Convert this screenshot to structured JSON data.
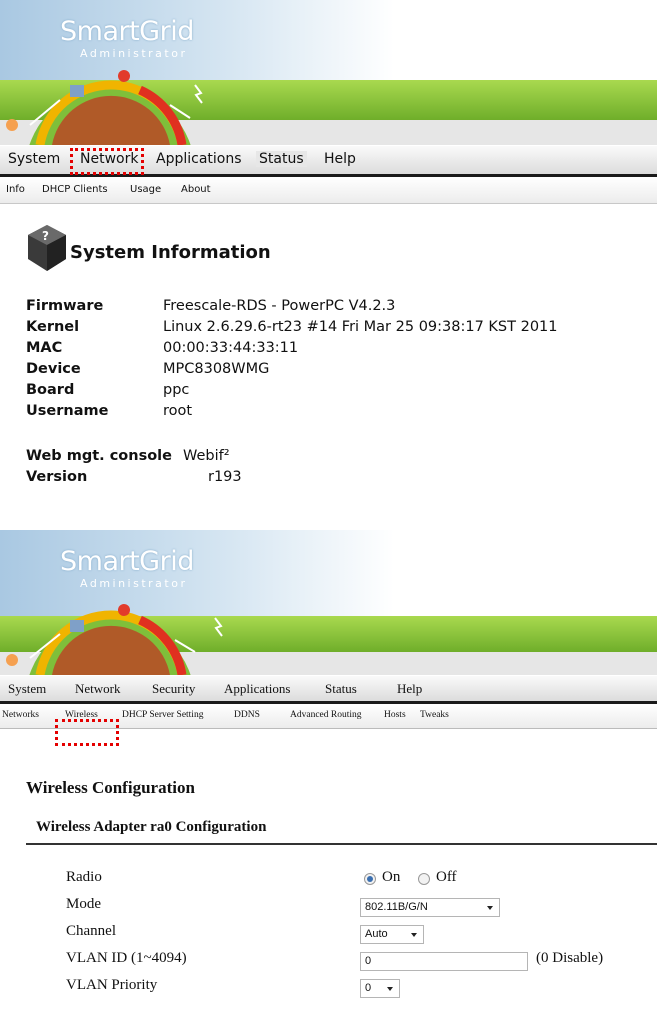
{
  "panel1": {
    "logo": {
      "title": "SmartGrid",
      "subtitle": "Administrator"
    },
    "menu": [
      "System",
      "Network",
      "Applications",
      "Status",
      "Help"
    ],
    "submenu": [
      "Info",
      "DHCP Clients",
      "Usage",
      "About"
    ],
    "page_title": "System Information",
    "info_rows": [
      {
        "label": "Firmware",
        "value": "Freescale-RDS - PowerPC V4.2.3"
      },
      {
        "label": "Kernel",
        "value": "Linux 2.6.29.6-rt23 #14 Fri Mar 25 09:38:17 KST 2011"
      },
      {
        "label": "MAC",
        "value": "00:00:33:44:33:11"
      },
      {
        "label": "Device",
        "value": "MPC8308WMG"
      },
      {
        "label": "Board",
        "value": "ppc"
      },
      {
        "label": "Username",
        "value": "root"
      }
    ],
    "web_console": {
      "label": "Web mgt. console",
      "value": "Webif²"
    },
    "version": {
      "label": "Version",
      "value": "r193"
    }
  },
  "panel2": {
    "logo": {
      "title": "SmartGrid",
      "subtitle": "Administrator"
    },
    "menu": [
      "System",
      "Network",
      "Security",
      "Applications",
      "Status",
      "Help"
    ],
    "submenu": [
      "Networks",
      "Wireless",
      "DHCP Server Setting",
      "DDNS",
      "Advanced Routing",
      "Hosts",
      "Tweaks"
    ],
    "page_title": "Wireless Configuration",
    "adapter_heading": "Wireless Adapter ra0 Configuration",
    "fields": {
      "radio": {
        "label": "Radio",
        "options": [
          "On",
          "Off"
        ],
        "selected": "On"
      },
      "mode": {
        "label": "Mode",
        "value": "802.11B/G/N"
      },
      "channel": {
        "label": "Channel",
        "value": "Auto"
      },
      "vlan_id": {
        "label": "VLAN ID (1~4094)",
        "value": "0",
        "note": "(0 Disable)"
      },
      "vlan_priority": {
        "label": "VLAN Priority",
        "value": "0"
      }
    }
  },
  "colors": {
    "highlight": "#e40000",
    "grass": "#8dc63f",
    "sky": "#bcd6ea"
  }
}
